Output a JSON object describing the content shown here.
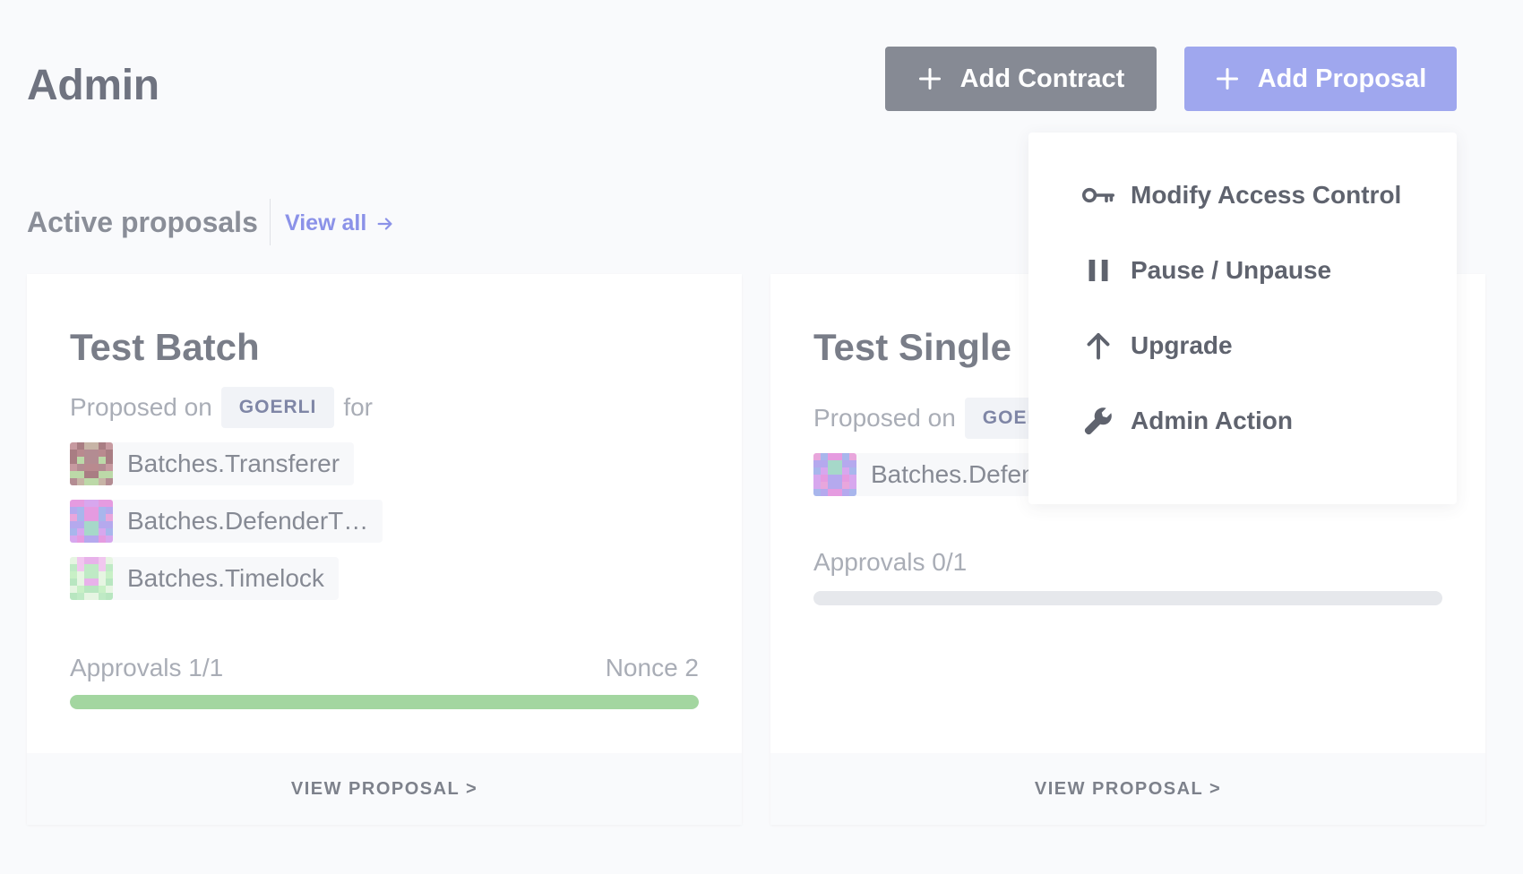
{
  "header": {
    "title": "Admin",
    "add_contract_label": "Add Contract",
    "add_proposal_label": "Add Proposal"
  },
  "section": {
    "title": "Active proposals",
    "view_all_label": "View all"
  },
  "cards": [
    {
      "title": "Test Batch",
      "proposed_on_label": "Proposed on",
      "network": "GOERLI",
      "for_label": "for",
      "contracts": [
        "Batches.Transferer",
        "Batches.DefenderT…",
        "Batches.Timelock"
      ],
      "approvals_label": "Approvals 1/1",
      "nonce_label": "Nonce 2",
      "approval_fraction": 1.0,
      "footer_label": "VIEW PROPOSAL >"
    },
    {
      "title": "Test Single",
      "proposed_on_label": "Proposed on",
      "network": "GOERLI",
      "contracts": [
        "Batches.DefenderT…"
      ],
      "approvals_label": "Approvals 0/1",
      "approval_fraction": 0.0,
      "footer_label": "VIEW PROPOSAL >"
    }
  ],
  "dropdown": {
    "items": [
      {
        "label": "Modify Access Control",
        "icon": "key-icon"
      },
      {
        "label": "Pause / Unpause",
        "icon": "pause-icon"
      },
      {
        "label": "Upgrade",
        "icon": "arrow-up-icon"
      },
      {
        "label": "Admin Action",
        "icon": "wrench-icon"
      }
    ]
  },
  "colors": {
    "add_contract_bg": "#868a94",
    "add_proposal_bg": "#9fa7ee",
    "accent_link": "#8b92e8",
    "progress_success": "#a3d6a0",
    "progress_track": "#e6e8ec"
  }
}
